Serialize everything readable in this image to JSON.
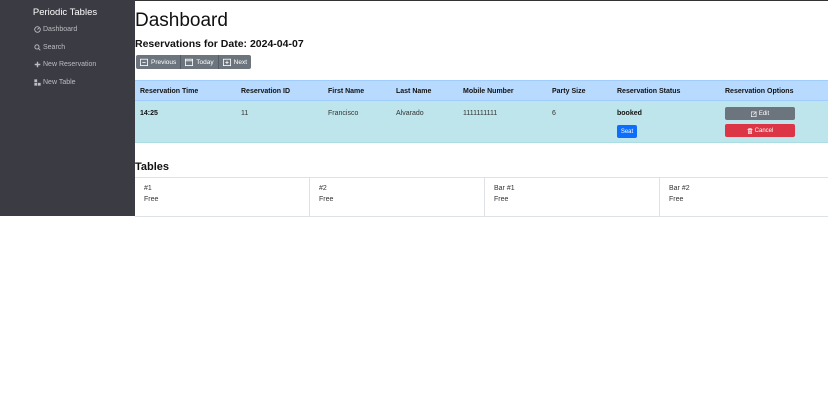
{
  "sidebar": {
    "brand": "Periodic Tables",
    "items": [
      {
        "label": "Dashboard",
        "icon": "dashboard-icon"
      },
      {
        "label": "Search",
        "icon": "search-icon"
      },
      {
        "label": "New Reservation",
        "icon": "plus-icon"
      },
      {
        "label": "New Table",
        "icon": "layout-icon"
      }
    ]
  },
  "main": {
    "title": "Dashboard",
    "date_heading": "Reservations for Date: 2024-04-07",
    "nav_buttons": {
      "previous": "Previous",
      "today": "Today",
      "next": "Next"
    }
  },
  "reservations": {
    "columns": [
      "Reservation Time",
      "Reservation ID",
      "First Name",
      "Last Name",
      "Mobile Number",
      "Party Size",
      "Reservation Status",
      "Reservation Options"
    ],
    "rows": [
      {
        "time": "14:25",
        "id": "11",
        "first_name": "Francisco",
        "last_name": "Alvarado",
        "mobile": "1111111111",
        "party_size": "6",
        "status": "booked",
        "seat_label": "Seat",
        "edit_label": "Edit",
        "cancel_label": "Cancel"
      }
    ]
  },
  "tables": {
    "heading": "Tables",
    "items": [
      {
        "name": "#1",
        "status": "Free"
      },
      {
        "name": "#2",
        "status": "Free"
      },
      {
        "name": "Bar #1",
        "status": "Free"
      },
      {
        "name": "Bar #2",
        "status": "Free"
      }
    ]
  },
  "colors": {
    "sidebar_bg": "#3a3b43",
    "header_row": "#b8daff",
    "data_row": "#bee5eb",
    "seat": "#0d6efd",
    "edit": "#6c757d",
    "cancel": "#dc3545"
  }
}
